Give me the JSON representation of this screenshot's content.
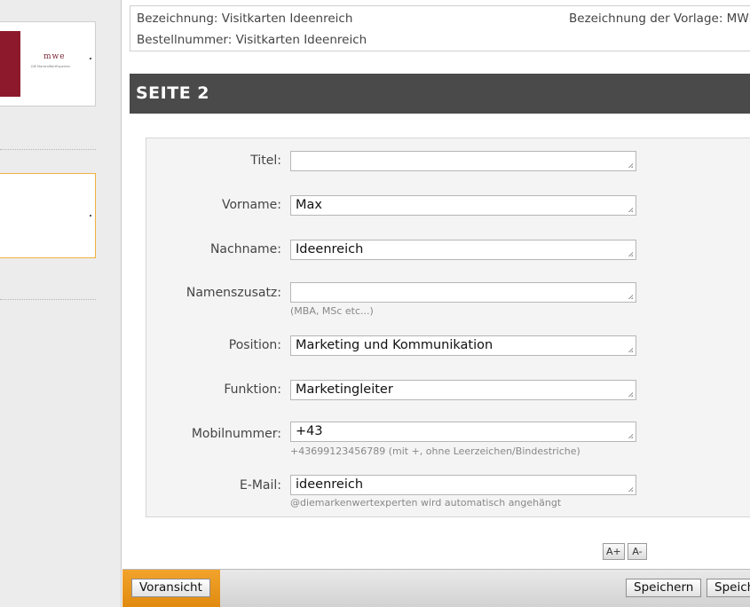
{
  "info": {
    "bezeichnung": "Bezeichnung: Visitkarten Ideenreich",
    "bestellnummer": "Bestellnummer: Visitkarten Ideenreich",
    "vorlage": "Bezeichnung der Vorlage: MWE"
  },
  "thumbnail": {
    "logo": "mwe",
    "tagline": "DIE MarkenWertExperten"
  },
  "section_title": "SEITE 2",
  "form": {
    "titel": {
      "label": "Titel:",
      "value": ""
    },
    "vorname": {
      "label": "Vorname:",
      "value": "Max"
    },
    "nachname": {
      "label": "Nachname:",
      "value": "Ideenreich"
    },
    "namenszusatz": {
      "label": "Namenszusatz:",
      "value": "",
      "hint": "(MBA, MSc etc...)"
    },
    "position": {
      "label": "Position:",
      "value": "Marketing und Kommunikation"
    },
    "funktion": {
      "label": "Funktion:",
      "value": "Marketingleiter"
    },
    "mobil": {
      "label": "Mobilnummer:",
      "value": "+43",
      "hint": "+43699123456789 (mit +, ohne Leerzeichen/Bindestriche)"
    },
    "email": {
      "label": "E-Mail:",
      "value": "ideenreich",
      "hint": "@diemarkenwertexperten wird automatisch angehängt"
    }
  },
  "font_buttons": {
    "increase": "A+",
    "decrease": "A-"
  },
  "bottom": {
    "preview": "Voransicht",
    "save": "Speichern",
    "save2": "Speich"
  },
  "colors": {
    "header_bg": "#4a4a4a",
    "accent_orange": "#e8951c",
    "thumb_red": "#8c1a2c"
  }
}
